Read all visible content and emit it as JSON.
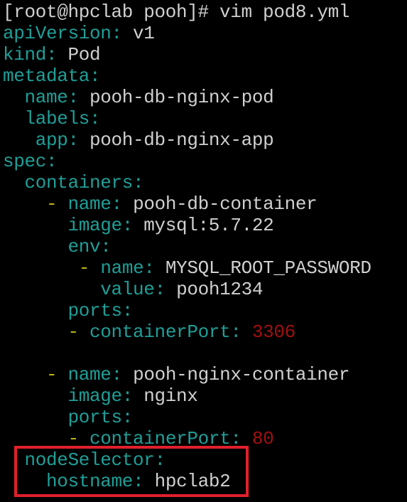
{
  "terminal": {
    "prompt": "[root@hpclab pooh]# vim pod8.yml",
    "colors": {
      "key": "#1f9f98",
      "value": "#d0d0d0",
      "dash": "#b9b41a",
      "number": "#a01010",
      "highlight": "#e0202a"
    },
    "yaml": {
      "apiVersion_key": "apiVersion",
      "apiVersion_val": "v1",
      "kind_key": "kind",
      "kind_val": "Pod",
      "metadata_key": "metadata",
      "name_key": "name",
      "pod_name": "pooh-db-nginx-pod",
      "labels_key": "labels",
      "app_key": "app",
      "app_val": "pooh-db-nginx-app",
      "spec_key": "spec",
      "containers_key": "containers",
      "c1_name": "pooh-db-container",
      "image_key": "image",
      "c1_image": "mysql:5.7.22",
      "env_key": "env",
      "env_name": "MYSQL_ROOT_PASSWORD",
      "value_key": "value",
      "env_value": "pooh1234",
      "ports_key": "ports",
      "containerPort_key": "containerPort",
      "c1_port": "3306",
      "c2_name": "pooh-nginx-container",
      "c2_image": "nginx",
      "c2_port": "80",
      "nodeSelector_key": "nodeSelector",
      "hostname_key": "hostname",
      "hostname_val": "hpclab2"
    }
  }
}
